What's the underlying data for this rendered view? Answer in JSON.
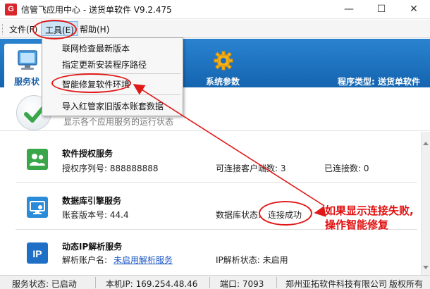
{
  "window": {
    "icon_glyph": "G",
    "title": "信管飞应用中心 - 送货单软件 V9.2.475",
    "controls": {
      "minimize": "—",
      "maximize": "☐",
      "close": "✕"
    }
  },
  "menubar": {
    "items": [
      {
        "label": "文件(F)"
      },
      {
        "label": "工具(E)"
      },
      {
        "label": "帮助(H)"
      }
    ]
  },
  "toolbar": {
    "tabs": [
      {
        "label": "服务状"
      },
      {
        "label": "系统参数"
      }
    ],
    "program_type": "程序类型: 送货单软件"
  },
  "dropdown": {
    "items": [
      {
        "label": "联网检查最新版本"
      },
      {
        "label": "指定更新安装程序路径"
      },
      {
        "label": "智能修复软件环境"
      },
      {
        "label": "导入红管家旧版本账套数据"
      }
    ]
  },
  "header": {
    "description": "显示各个应用服务的运行状态"
  },
  "services": [
    {
      "title": "软件授权服务",
      "icon": "users-icon",
      "color": "#3aa64a",
      "field1": "授权序列号: 888888888",
      "field2": "可连接客户端数: 3",
      "field3": "已连接数:  0"
    },
    {
      "title": "数据库引擎服务",
      "icon": "database-monitor-icon",
      "color": "#2a8bd8",
      "field1": "账套版本号: 44.4",
      "field2_label": "数据库状态:",
      "field2_value": "连接成功"
    },
    {
      "title": "动态IP解析服务",
      "icon": "ip-icon",
      "color": "#1f6fc6",
      "field1_label": "解析账户名:",
      "field1_link": "未启用解析服务",
      "field2": "IP解析状态: 未启用"
    }
  ],
  "statusbar": {
    "service_state": "服务状态: 已启动",
    "local_ip": "本机IP: 169.254.48.46",
    "port": "端口: 7093",
    "company": "郑州亚拓软件科技有限公司",
    "copyright": "版权所有"
  },
  "annotation": {
    "line1": "如果显示连接失败,",
    "line2": "操作智能修复",
    "color": "#e01010"
  }
}
